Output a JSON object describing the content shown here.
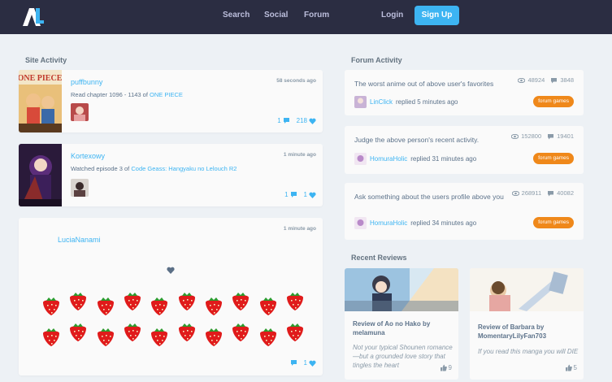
{
  "nav": {
    "logo_text": "AL",
    "links": [
      "Search",
      "Social",
      "Forum"
    ],
    "login": "Login",
    "signup": "Sign Up"
  },
  "site_activity": {
    "title": "Site Activity",
    "items": [
      {
        "user": "puffbunny",
        "time": "58 seconds ago",
        "prefix": "Read chapter 1096 - 1143 of",
        "media": "ONE PIECE",
        "replies": "1",
        "likes": "218",
        "cover_text": "ONE PIECE"
      },
      {
        "user": "Kortexowy",
        "time": "1 minute ago",
        "prefix": "Watched episode 3 of",
        "media": "Code Geass: Hangyaku no Lelouch R2",
        "replies": "1",
        "likes": "1"
      },
      {
        "user": "LuciaNanami",
        "time": "1 minute ago",
        "replies": "",
        "likes": "1"
      }
    ]
  },
  "forum_activity": {
    "title": "Forum Activity",
    "items": [
      {
        "title": "The worst anime out of above user's favorites",
        "views": "48924",
        "replies": "3848",
        "user": "LinClick",
        "text": "replied 5 minutes ago",
        "tag": "forum games"
      },
      {
        "title": "Judge the above person's recent activity.",
        "views": "152800",
        "replies": "19401",
        "user": "HomuraHolic",
        "text": "replied 31 minutes ago",
        "tag": "forum games"
      },
      {
        "title": "Ask something about the users profile above you",
        "views": "268911",
        "replies": "40082",
        "user": "HomuraHolic",
        "text": "replied 34 minutes ago",
        "tag": "forum games"
      }
    ]
  },
  "recent_reviews": {
    "title": "Recent Reviews",
    "items": [
      {
        "title": "Review of Ao no Hako by melamuna",
        "summary": "Not your typical Shounen romance—but a grounded love story that tingles the heart",
        "score": "9"
      },
      {
        "title": "Review of Barbara by MomentaryLilyFan703",
        "summary": "If you read this manga you will DIE",
        "score": "5"
      }
    ]
  },
  "colors": {
    "nav_bg": "#2b2d42",
    "accent": "#3db4f2",
    "tag": "#ef881a",
    "page_bg": "#edf1f5"
  }
}
